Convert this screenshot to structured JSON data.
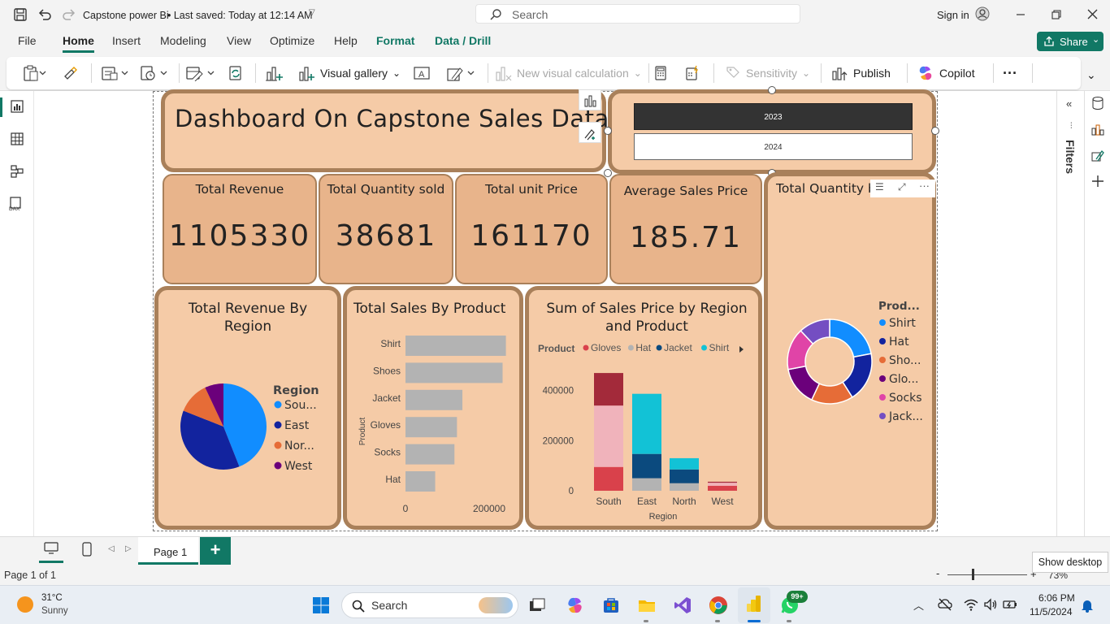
{
  "titlebar": {
    "file_name": "Capstone power Bi",
    "saved": "• Last saved: Today at 12:14 AM",
    "search_placeholder": "Search",
    "sign_in": "Sign in"
  },
  "ribbon_tabs": [
    "File",
    "Home",
    "Insert",
    "Modeling",
    "View",
    "Optimize",
    "Help",
    "Format",
    "Data / Drill"
  ],
  "share_label": "Share",
  "toolbar": {
    "visual_gallery": "Visual gallery",
    "new_visual_calc": "New visual calculation",
    "sensitivity": "Sensitivity",
    "publish": "Publish",
    "copilot": "Copilot",
    "more": "···"
  },
  "right_pane": {
    "filters": "Filters"
  },
  "dashboard": {
    "title": "Dashboard  On Capstone Sales Data",
    "slicer_years": [
      "2023",
      "2024"
    ],
    "kpis": [
      {
        "label": "Total Revenue",
        "value": "1105330"
      },
      {
        "label": "Total Quantity sold",
        "value": "38681"
      },
      {
        "label": "Total unit Price",
        "value": "161170"
      },
      {
        "label": "Average Sales Price",
        "value": "185.71"
      }
    ],
    "revenue_by_region": {
      "title": "Total Revenue By Region",
      "legend_title": "Region",
      "legend": [
        "Sou...",
        "East",
        "Nor...",
        "West"
      ]
    },
    "sales_by_product": {
      "title": "Total Sales By Product",
      "axis_label": "Product"
    },
    "sales_by_region_product": {
      "title_line1": "Sum of Sales Price by Region",
      "title_line2": "and Product",
      "legend_title": "Product",
      "xlabel": "Region"
    },
    "quantity_donut": {
      "title": "Total Quantity b",
      "legend_title": "Prod...",
      "legend": [
        "Shirt",
        "Hat",
        "Sho...",
        "Glo...",
        "Socks",
        "Jack..."
      ]
    }
  },
  "chart_data": [
    {
      "type": "pie",
      "title": "Total Revenue By Region",
      "categories": [
        "South",
        "East",
        "North",
        "West"
      ],
      "values": [
        44,
        37,
        12,
        7
      ],
      "colors": [
        "#118dff",
        "#12239e",
        "#e66c37",
        "#6b007b"
      ]
    },
    {
      "type": "bar",
      "orientation": "horizontal",
      "title": "Total Sales By Product",
      "ylabel": "Product",
      "categories": [
        "Shirt",
        "Shoes",
        "Jacket",
        "Gloves",
        "Socks",
        "Hat"
      ],
      "values": [
        240000,
        232000,
        136000,
        123000,
        117000,
        71000
      ],
      "xticks": [
        "0",
        "200000"
      ],
      "xlim": [
        0,
        300000
      ],
      "color": "#b3b3b3"
    },
    {
      "type": "bar",
      "stacked": true,
      "title": "Sum of Sales Price by Region and Product",
      "xlabel": "Region",
      "categories": [
        "South",
        "East",
        "North",
        "West"
      ],
      "yticks": [
        "0",
        "200000",
        "400000"
      ],
      "ylim": [
        0,
        480000
      ],
      "series": [
        {
          "name": "Gloves",
          "color": "#d9414b",
          "values": [
            95000,
            0,
            0,
            20000
          ]
        },
        {
          "name": "Hat",
          "color": "#b3b3b3",
          "values": [
            0,
            50000,
            30000,
            0
          ]
        },
        {
          "name": "Jacket",
          "color": "#0b4a7e",
          "values": [
            0,
            97000,
            55000,
            0
          ]
        },
        {
          "name": "Shirt",
          "color": "#12c2d6",
          "values": [
            0,
            240000,
            45000,
            0
          ]
        },
        {
          "name": "",
          "color": "#f0b3bb",
          "values": [
            245000,
            0,
            0,
            12000
          ]
        },
        {
          "name": "",
          "color": "#a32a3a",
          "values": [
            130000,
            0,
            0,
            4000
          ]
        }
      ]
    },
    {
      "type": "pie",
      "donut": true,
      "title": "Total Quantity b",
      "categories": [
        "Shirt",
        "Hat",
        "Shoes",
        "Gloves",
        "Socks",
        "Jacket"
      ],
      "values": [
        22,
        19,
        16,
        15,
        16,
        12
      ],
      "colors": [
        "#118dff",
        "#12239e",
        "#e66c37",
        "#6b007b",
        "#e044a7",
        "#744ec2"
      ]
    }
  ],
  "pagebar": {
    "page": "Page 1",
    "status": "Page 1 of 1",
    "show_desktop": "Show desktop",
    "zoom": "73%"
  },
  "taskbar": {
    "temp": "31°C",
    "weather": "Sunny",
    "search": "Search",
    "badge": "99+",
    "time": "6:06 PM",
    "date": "11/5/2024"
  }
}
